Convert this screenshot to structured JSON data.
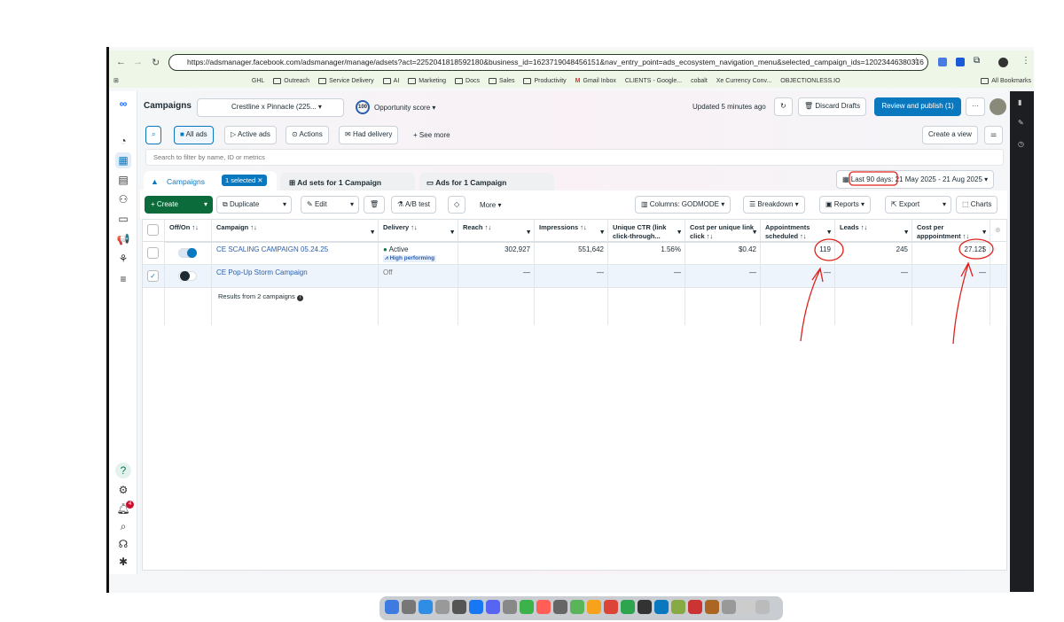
{
  "browser": {
    "url": "https://adsmanager.facebook.com/adsmanager/manage/adsets?act=2252041818592180&business_id=1623719048456151&nav_entry_point=ads_ecosystem_navigation_menu&selected_campaign_ids=12023446380316",
    "bookmarks": [
      "GHL",
      "Outreach",
      "Service Delivery",
      "AI",
      "Marketing",
      "Docs",
      "Sales",
      "Productivity",
      "Gmail Inbox",
      "CLIENTS - Google...",
      "cobalt",
      "Xe Currency Conv...",
      "OBJECTIONLESS.IO"
    ],
    "all_bookmarks": "All Bookmarks"
  },
  "header": {
    "title": "Campaigns",
    "account": "Crestline x Pinnacle (225...",
    "score": "100",
    "score_label": "Opportunity score",
    "updated": "Updated 5 minutes ago",
    "discard": "Discard Drafts",
    "publish": "Review and publish (1)",
    "more": "···"
  },
  "filters": {
    "all_ads": "All ads",
    "active_ads": "Active ads",
    "actions": "Actions",
    "had_delivery": "Had delivery",
    "see_more": "See more",
    "create_view": "Create a view",
    "search_placeholder": "Search to filter by name, ID or metrics"
  },
  "tabs": {
    "campaigns": "Campaigns",
    "selected": "1 selected",
    "adsets": "Ad sets for 1 Campaign",
    "ads": "Ads for 1 Campaign",
    "date_preset": "Last 90 days:",
    "date_range": "21 May 2025 - 21 Aug 2025"
  },
  "toolbar": {
    "create": "Create",
    "duplicate": "Duplicate",
    "edit": "Edit",
    "ab_test": "A/B test",
    "more": "More",
    "columns": "Columns: GODMODE",
    "breakdown": "Breakdown",
    "reports": "Reports",
    "export": "Export",
    "charts": "Charts"
  },
  "table": {
    "headers": [
      "Off/On ↑↓",
      "Campaign ↑↓",
      "Delivery ↑↓",
      "Reach ↑↓",
      "Impressions ↑↓",
      "Unique CTR (link click-through...",
      "Cost per unique link click ↑↓",
      "Appointments scheduled ↑↓",
      "Leads ↑↓",
      "Cost per apppointment ↑↓"
    ],
    "rows": [
      {
        "on": true,
        "checked": false,
        "name": "CE SCALING CAMPAIGN 05.24.25",
        "delivery": "Active",
        "badge": "High performing",
        "reach": "302,927",
        "impressions": "551,642",
        "ctr": "1.56%",
        "cpc": "$0.42",
        "appointments": "119",
        "leads": "245",
        "cpa": "27.12$"
      },
      {
        "on": false,
        "checked": true,
        "name": "CE Pop-Up Storm Campaign",
        "delivery": "Off",
        "badge": "",
        "reach": "—",
        "impressions": "—",
        "ctr": "—",
        "cpc": "—",
        "appointments": "—",
        "leads": "—",
        "cpa": "—"
      }
    ],
    "footer": "Results from 2 campaigns"
  },
  "sidebar": {
    "notifications": "4"
  },
  "colors": {
    "accent": "#0a78be",
    "create": "#0b6b3a",
    "annotation": "#e0201a",
    "active": "#0b7a4a"
  }
}
